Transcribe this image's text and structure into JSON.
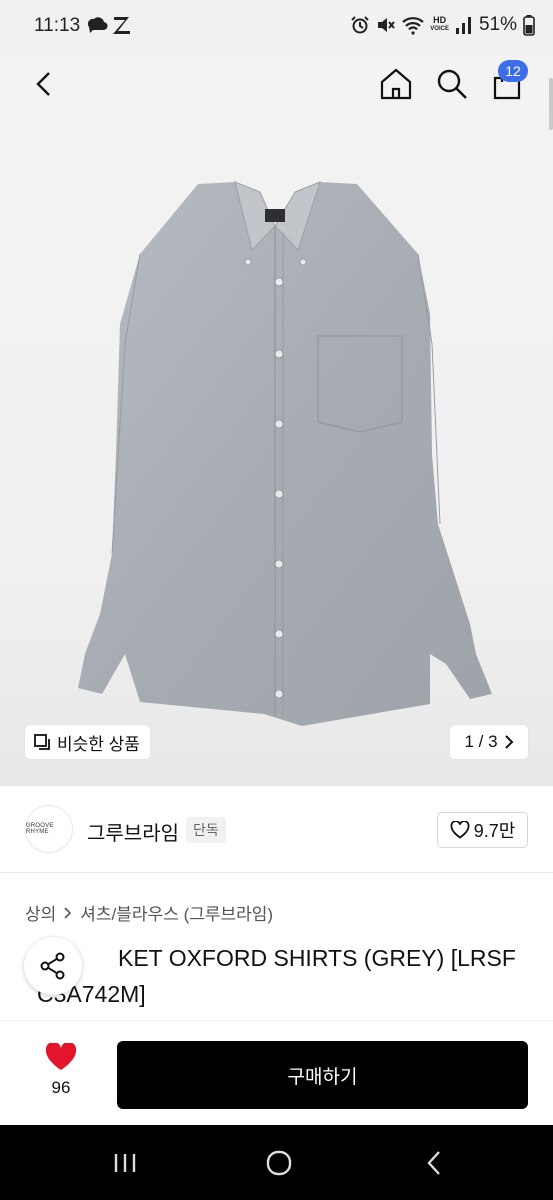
{
  "status_bar": {
    "time": "11:13",
    "left_icons": [
      "cloud-chat-icon",
      "z-icon"
    ],
    "right_icons": [
      "alarm-icon",
      "mute-icon",
      "wifi-icon",
      "hd-voice-icon",
      "signal-icon",
      "battery-icon"
    ],
    "hd_top": "HD",
    "hd_bottom": "VOICE",
    "battery": "51%"
  },
  "header": {
    "back_icon": "chevron-left-icon",
    "home_icon": "home-icon",
    "search_icon": "search-icon",
    "cart_icon": "cart-icon",
    "cart_badge": "12",
    "badge_color": "#3b6ee8"
  },
  "hero": {
    "similar_label": "비슷한 상품",
    "pager": "1 / 3"
  },
  "brand": {
    "logo_text": "GROOVE RHYME",
    "name": "그루브라임",
    "tag": "단독",
    "likes": "9.7만"
  },
  "product": {
    "breadcrumb": [
      "상의",
      "셔츠/블라우스 (그루브라임)"
    ],
    "title_line1": "KET OXFORD SHIRTS (GREY) [LRSF",
    "title_line2": "C3A742M]"
  },
  "bottom": {
    "fav_count": "96",
    "heart_color": "#e3142b",
    "buy_label": "구매하기"
  },
  "system_nav": [
    "recent-apps-icon",
    "home-circle-icon",
    "back-icon"
  ]
}
